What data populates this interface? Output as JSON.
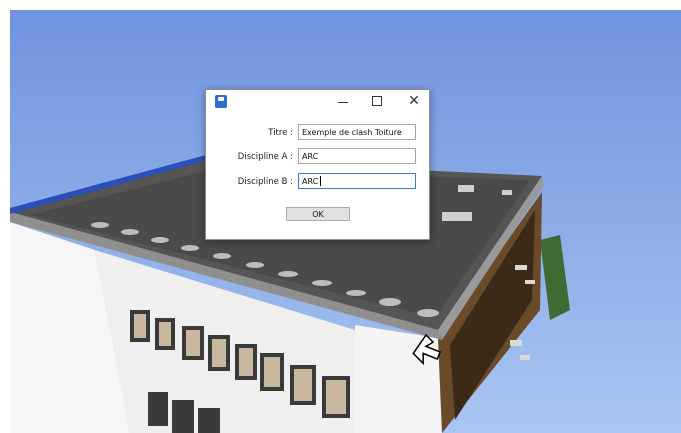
{
  "dialog": {
    "icon": "app-icon",
    "controls": {
      "minimize_icon": "minimize-icon",
      "maximize_icon": "maximize-icon",
      "close_label": "✕"
    },
    "fields": [
      {
        "label": "Titre :",
        "value": "Exemple de clash Toiture"
      },
      {
        "label": "Discipline A :",
        "value": "ARC"
      },
      {
        "label": "Discipline B :",
        "value": "ARC"
      }
    ],
    "ok_label": "OK"
  },
  "colors": {
    "sky": "#8aaee8",
    "roof": "#4a4a4a",
    "wall": "#f2f2f2",
    "accent": "#2f6bd1"
  },
  "scene": {
    "cursor_icon": "mouse-pointer-icon"
  }
}
